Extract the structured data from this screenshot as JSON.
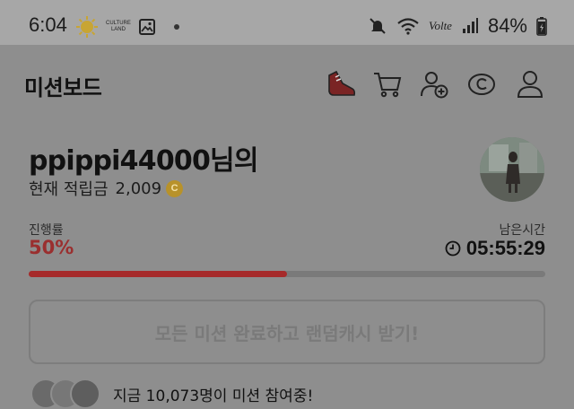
{
  "status_bar": {
    "time": "6:04",
    "culture_land_line1": "CULTURE",
    "culture_land_line2": "LAND",
    "network": "Volte",
    "battery": "84%"
  },
  "header": {
    "title": "미션보드",
    "icons": [
      "shoe-icon",
      "cart-icon",
      "add-friend-icon",
      "coin-c-icon",
      "profile-icon"
    ]
  },
  "user": {
    "username_line": "ppippi44000님의",
    "points_label": "현재 적립금",
    "points_value": "2,009",
    "coin_symbol": "C"
  },
  "progress": {
    "label": "진행률",
    "percent_text": "50%",
    "value": 0.5,
    "remaining_label": "남은시간",
    "remaining_time": "05:55:29"
  },
  "cta": {
    "label": "모든 미션 완료하고 랜덤캐시 받기!"
  },
  "joined": {
    "text": "지금 10,073명이 미션 참여중!"
  },
  "colors": {
    "accent": "#a62a2a",
    "overlay": "#8e8e8e"
  }
}
